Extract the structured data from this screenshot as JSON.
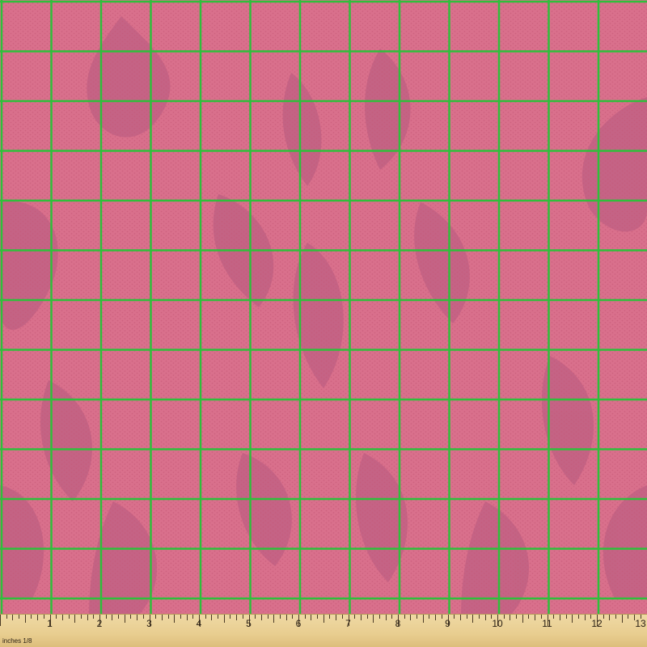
{
  "fabric": {
    "base_color": "#d9708c",
    "dot_color": "#c55877",
    "shadow_color": "#b4597f",
    "grid_color": "#2fbf3b",
    "grid_count": 13
  },
  "ruler": {
    "unit_label": "inches 1/8",
    "numbers": [
      "1",
      "2",
      "3",
      "4",
      "5",
      "6",
      "7",
      "8",
      "9",
      "10",
      "11",
      "12",
      "13"
    ]
  }
}
